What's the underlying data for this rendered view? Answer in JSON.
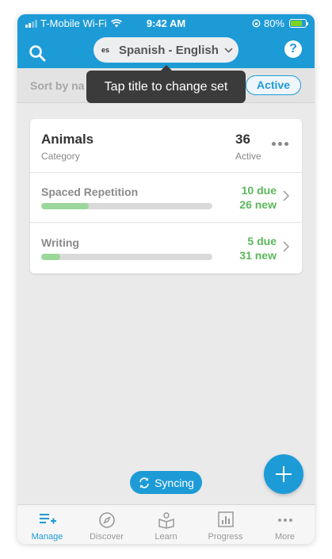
{
  "status_bar": {
    "carrier": "T-Mobile Wi-Fi",
    "time": "9:42 AM",
    "battery": "80%",
    "battery_level": 0.8
  },
  "header": {
    "search_icon": "search-icon",
    "lang_code": "es",
    "set_title": "Spanish - English",
    "help_label": "?"
  },
  "sort_bar": {
    "label": "Sort by na",
    "filter_label": "Active"
  },
  "tooltip": {
    "text": "Tap title to change set"
  },
  "category_card": {
    "title": "Animals",
    "subtitle": "Category",
    "count": "36",
    "count_label": "Active",
    "modes": [
      {
        "name": "Spaced Repetition",
        "due": "10 due",
        "new": "26 new",
        "progress": 0.28
      },
      {
        "name": "Writing",
        "due": "5 due",
        "new": "31 new",
        "progress": 0.11
      }
    ]
  },
  "sync": {
    "label": "Syncing"
  },
  "tabs": [
    {
      "label": "Manage",
      "icon": "manage-list-icon",
      "active": true
    },
    {
      "label": "Discover",
      "icon": "compass-icon",
      "active": false
    },
    {
      "label": "Learn",
      "icon": "learn-book-icon",
      "active": false
    },
    {
      "label": "Progress",
      "icon": "progress-chart-icon",
      "active": false
    },
    {
      "label": "More",
      "icon": "more-dots-icon",
      "active": false
    }
  ],
  "colors": {
    "brand_blue": "#1d9bd7",
    "due_green": "#5cb85c",
    "progress_green": "#9bd79b"
  }
}
